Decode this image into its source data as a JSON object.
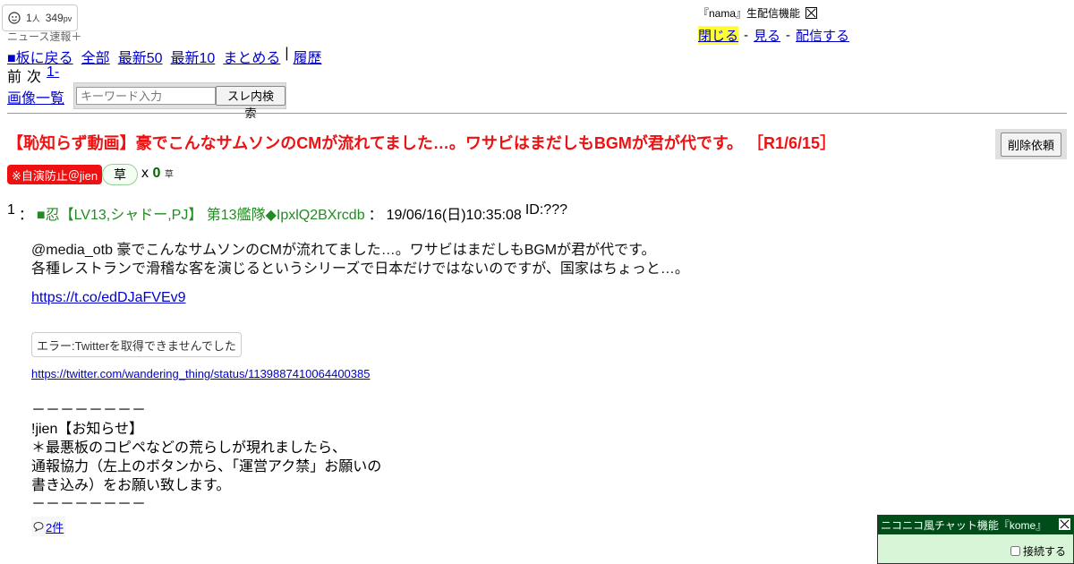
{
  "header": {
    "counter": {
      "viewers": "1",
      "viewers_unit": "人",
      "pv": "349",
      "pv_unit": "pv"
    },
    "board_name": "ニュース速報＋",
    "nav": {
      "back": "■板に戻る",
      "all": "全部",
      "latest50": "最新50",
      "latest10": "最新10",
      "summarize": "まとめる",
      "separator": "|",
      "history": "履歴"
    },
    "prev": "前",
    "next": "次",
    "range": "1-",
    "image_list": "画像一覧",
    "search": {
      "placeholder": "キーワード入力",
      "button": "スレ内検索"
    }
  },
  "nama": {
    "title": "『nama』生配信機能",
    "close": "閉じる",
    "dash1": "-",
    "watch": "見る",
    "dash2": "-",
    "broadcast": "配信する"
  },
  "thread": {
    "title": "【恥知らず動画】豪でこんなサムソンのCMが流れてました…。ワサビはまだしもBGMが君が代です。 ［R1/6/15］",
    "delete_button": "削除依頼",
    "jien_badge": "※自演防止＠jien",
    "kusa_button": "草",
    "kusa_x": "x",
    "kusa_count": "0",
    "kusa_unit": "草"
  },
  "post": {
    "number": "1",
    "colon1": "：",
    "name": "■忍【LV13,シャドー,PJ】 第13艦隊◆IpxlQ2BXrcdb",
    "colon2": "：",
    "datetime": "19/06/16(日)10:35:08",
    "id": "ID:???",
    "body_line1": "@media_otb 豪でこんなサムソンのCMが流れてました…。ワサビはまだしもBGMが君が代です。",
    "body_line2": "各種レストランで滑稽な客を演じるというシリーズで日本だけではないのですが、国家はちょっと…。",
    "link1": "https://t.co/edDJaFVEv9",
    "twitter_error": "エラー:Twitterを取得できませんでした",
    "link2": "https://twitter.com/wandering_thing/status/1139887410064400385",
    "notice_lines": [
      "－－－－－－－－",
      "!jien【お知らせ】",
      "＊最悪板のコピペなどの荒らしが現れましたら、",
      "通報協力（左上のボタンから、「運営アク禁」お願いの",
      "書き込み）をお願い致します。",
      "－－－－－－－－"
    ],
    "reply_count": "2件"
  },
  "chat": {
    "title": "ニコニコ風チャット機能『kome』",
    "connect_label": "接続する"
  }
}
